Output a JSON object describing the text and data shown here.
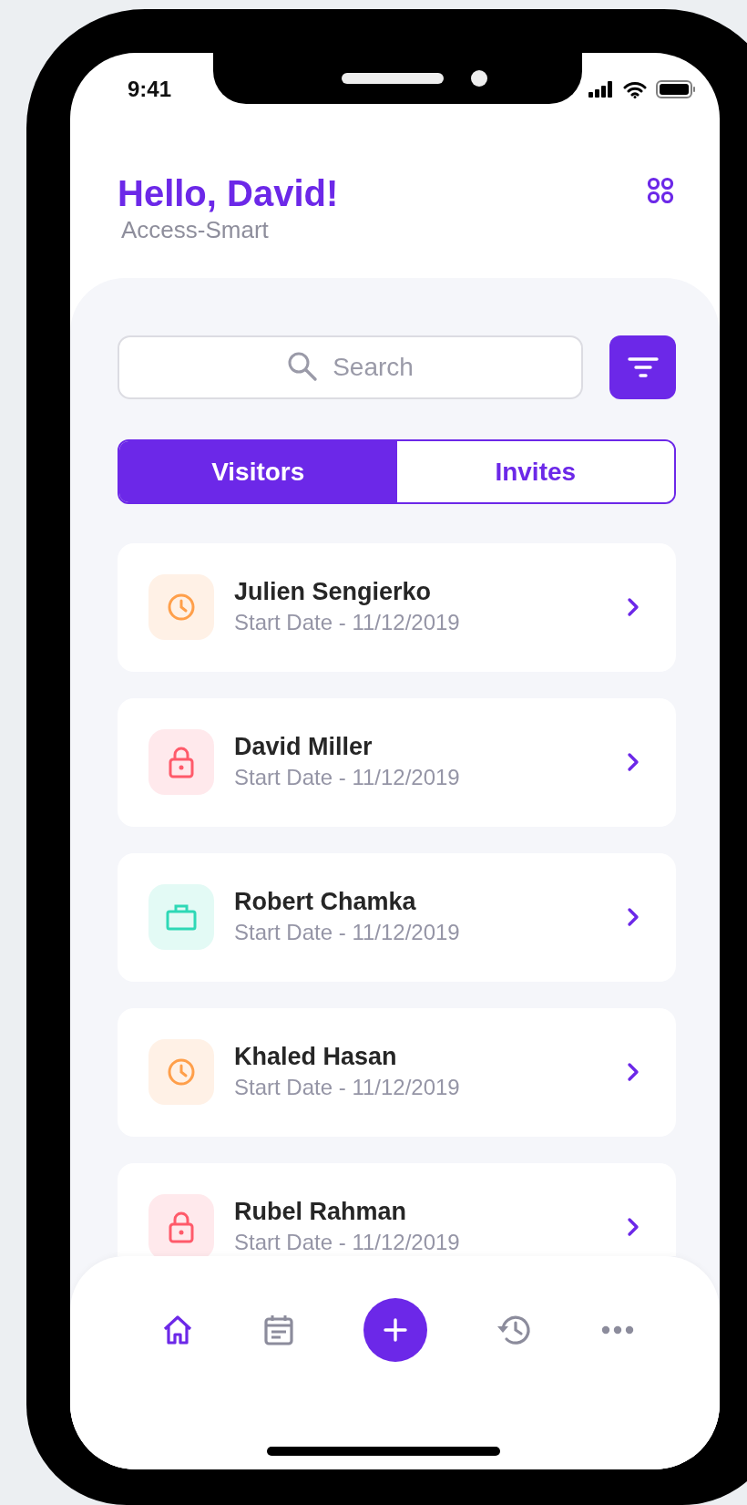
{
  "status_bar": {
    "time": "9:41"
  },
  "header": {
    "title": "Hello, David!",
    "subtitle": "Access-Smart"
  },
  "search": {
    "placeholder": "Search"
  },
  "tabs": [
    {
      "label": "Visitors",
      "selected": true
    },
    {
      "label": "Invites",
      "selected": false
    }
  ],
  "visitors": [
    {
      "kind": "clock",
      "name": "Julien Sengierko",
      "date": "Start Date - 11/12/2019"
    },
    {
      "kind": "lock",
      "name": "David Miller",
      "date": "Start Date - 11/12/2019"
    },
    {
      "kind": "briefcase",
      "name": "Robert Chamka",
      "date": "Start Date - 11/12/2019"
    },
    {
      "kind": "clock",
      "name": "Khaled Hasan",
      "date": "Start Date - 11/12/2019"
    },
    {
      "kind": "lock",
      "name": "Rubel Rahman",
      "date": "Start Date - 11/12/2019"
    }
  ],
  "nav": [
    {
      "kind": "home",
      "selected": true
    },
    {
      "kind": "calendar",
      "selected": false
    },
    {
      "kind": "add",
      "selected": false
    },
    {
      "kind": "history",
      "selected": false
    },
    {
      "kind": "more",
      "selected": false
    }
  ]
}
